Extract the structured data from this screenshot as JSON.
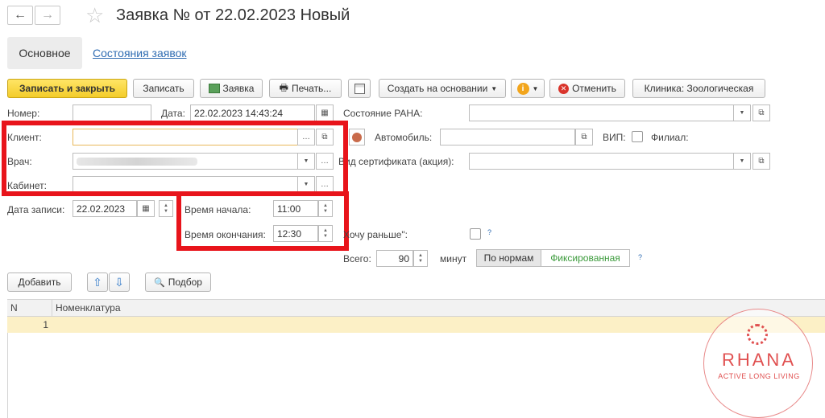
{
  "window": {
    "title": "Заявка №  от 22.02.2023 Новый"
  },
  "tabs": {
    "main": "Основное",
    "states_link": "Состояния заявок"
  },
  "toolbar": {
    "save_close": "Записать и закрыть",
    "save": "Записать",
    "request": "Заявка",
    "print": "Печать...",
    "create_based": "Создать на основании",
    "cancel": "Отменить",
    "clinic": "Клиника: Зоологическая"
  },
  "form": {
    "number_label": "Номер:",
    "number_value": "",
    "date_label": "Дата:",
    "date_value": "22.02.2023 14:43:24",
    "raha_label": "Состояние РАНА:",
    "client_label": "Клиент:",
    "client_value": "",
    "car_label": "Автомобиль:",
    "vip_label": "ВИП:",
    "branch_label": "Филиал:",
    "doctor_label": "Врач:",
    "cert_label": "Вид сертификата (акция):",
    "cabinet_label": "Кабинет:",
    "record_date_label": "Дата записи:",
    "record_date_value": "22.02.2023",
    "start_label": "Время начала:",
    "start_value": "11:00",
    "end_label": "Время окончания:",
    "end_value": "12:30",
    "earlier_label": "Хочу раньше\":",
    "total_label": "Всего:",
    "total_value": "90",
    "minutes_label": "минут",
    "by_norms": "По нормам",
    "fixed": "Фиксированная"
  },
  "table_toolbar": {
    "add": "Добавить",
    "pick": "Подбор"
  },
  "table": {
    "columns": [
      "N",
      "Номенклатура"
    ],
    "rows": [
      {
        "n": "1",
        "item": ""
      }
    ]
  },
  "watermark": {
    "brand": "RHANA",
    "tagline": "ACTIVE LONG LIVING"
  },
  "colors": {
    "primary_button": "#f3cc2a",
    "highlight": "#e8141b",
    "link": "#2f6cb2",
    "fixed": "#3a9a3a",
    "watermark": "#e05050"
  }
}
